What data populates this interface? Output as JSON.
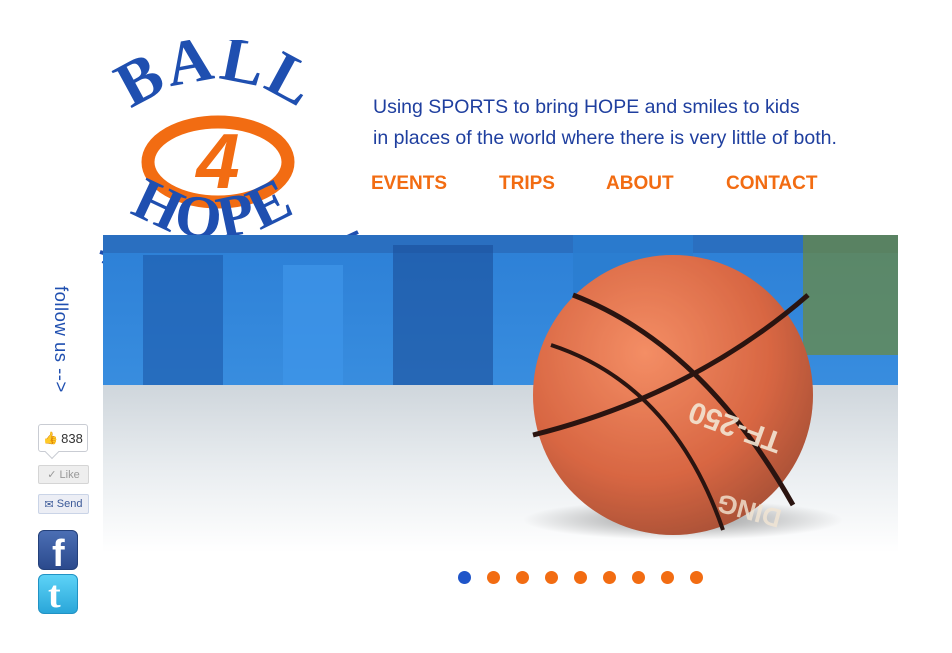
{
  "logo": {
    "top_word": "BALL",
    "center_mark": "4",
    "bottom_word": "HOPE",
    "colors": {
      "blue": "#1f4fb0",
      "orange": "#f26c12"
    }
  },
  "tagline": {
    "line1": "Using SPORTS to bring HOPE and smiles to kids",
    "line2": "in places of the world where there is very little of both."
  },
  "nav": {
    "items": [
      {
        "label": "EVENTS"
      },
      {
        "label": "TRIPS"
      },
      {
        "label": "ABOUT"
      },
      {
        "label": "CONTACT"
      }
    ]
  },
  "hero": {
    "basketball_print": "TF-250",
    "basketball_print_lower": "DING"
  },
  "slider": {
    "total": 9,
    "active_index": 0,
    "colors": {
      "active": "#1f55c9",
      "inactive": "#f26c12"
    }
  },
  "sidebar": {
    "follow_label": "follow us -->",
    "like_count": "838",
    "like_label": "Like",
    "send_label": "Send",
    "facebook_icon": "f",
    "twitter_icon": "t"
  }
}
